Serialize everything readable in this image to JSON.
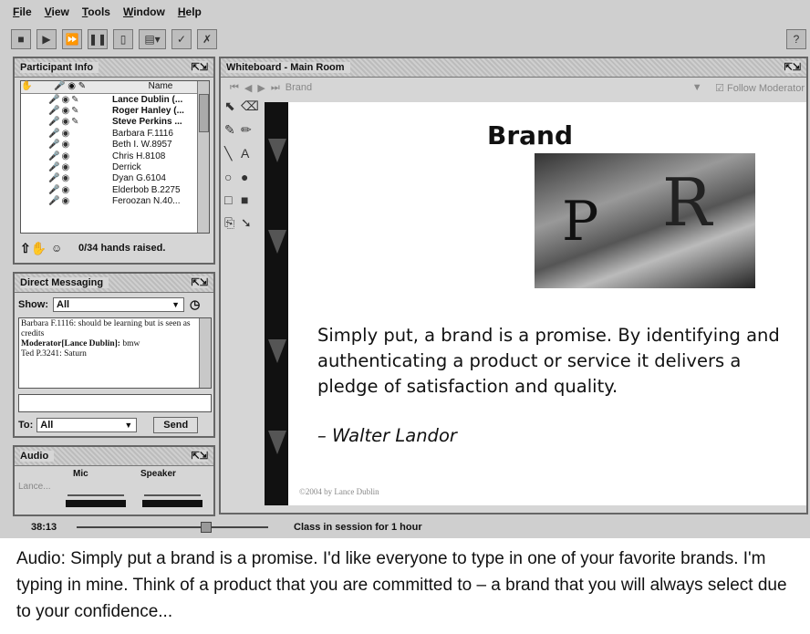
{
  "menu": [
    "File",
    "View",
    "Tools",
    "Window",
    "Help"
  ],
  "participant_panel": {
    "title": "Participant Info",
    "col_name": "Name",
    "participants": [
      {
        "name": "Lance Dublin (...",
        "bold": true
      },
      {
        "name": "Roger Hanley (...",
        "bold": true
      },
      {
        "name": "Steve Perkins ...",
        "bold": true
      },
      {
        "name": "Barbara F.1116",
        "bold": false
      },
      {
        "name": "Beth I. W.8957",
        "bold": false
      },
      {
        "name": "Chris H.8108",
        "bold": false
      },
      {
        "name": "Derrick",
        "bold": false
      },
      {
        "name": "Dyan G.6104",
        "bold": false
      },
      {
        "name": "Elderbob B.2275",
        "bold": false
      },
      {
        "name": "Feroozan N.40...",
        "bold": false
      }
    ],
    "hands_raised": "0/34 hands raised."
  },
  "direct_messaging": {
    "title": "Direct Messaging",
    "show_label": "Show:",
    "show_value": "All",
    "messages": [
      {
        "sender": "Barbara F.1116:",
        "text": "should be learning but is seen as credits"
      },
      {
        "sender": "Moderator[Lance Dublin]:",
        "text": "bmw"
      },
      {
        "sender": "Ted P.3241:",
        "text": "Saturn"
      }
    ],
    "to_label": "To:",
    "to_value": "All",
    "send_label": "Send"
  },
  "audio": {
    "title": "Audio",
    "user": "Lance...",
    "mic_label": "Mic",
    "speaker_label": "Speaker"
  },
  "whiteboard": {
    "title": "Whiteboard - Main Room",
    "page": "Brand",
    "follow": "Follow Moderator",
    "slide": {
      "title": "Brand",
      "quote": "Simply put, a brand is a promise. By identifying and authenticating a product or service it delivers a pledge of satisfaction and quality.",
      "author": "– Walter Landor",
      "copyright": "©2004 by Lance Dublin"
    }
  },
  "status": {
    "time": "38:13",
    "message": "Class in session for 1 hour"
  },
  "caption": "Audio: Simply put a brand is a promise.  I'd like everyone to type in one of your favorite brands.  I'm typing in mine. Think of a product that you are committed to – a brand that you will always select due to your confidence..."
}
